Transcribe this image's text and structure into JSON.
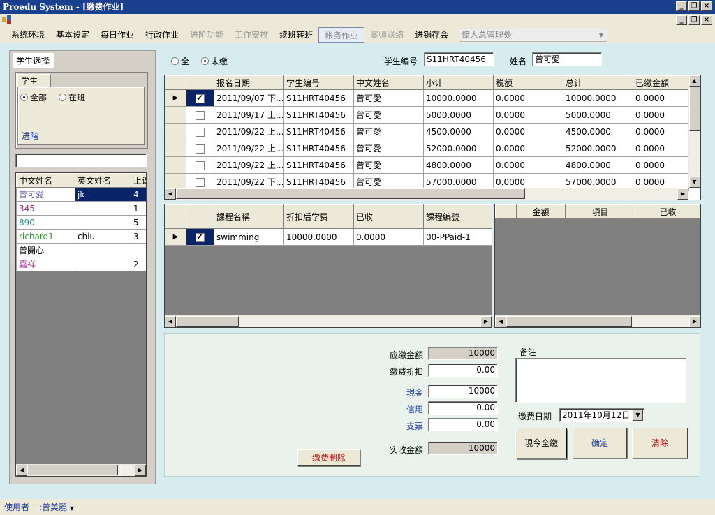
{
  "window": {
    "title": "Proedu System - [缴费作业]"
  },
  "menu": {
    "items": [
      {
        "label": "系统环境",
        "state": "normal"
      },
      {
        "label": "基本设定",
        "state": "normal"
      },
      {
        "label": "每日作业",
        "state": "normal"
      },
      {
        "label": "行政作业",
        "state": "normal"
      },
      {
        "label": "进阶功能",
        "state": "disabled"
      },
      {
        "label": "工作安排",
        "state": "disabled"
      },
      {
        "label": "续班转班",
        "state": "normal"
      },
      {
        "label": "帐务作业",
        "state": "boxed"
      },
      {
        "label": "案师联络",
        "state": "disabled"
      },
      {
        "label": "进销存会",
        "state": "normal"
      }
    ],
    "combo_value": "傑人总管理处"
  },
  "left": {
    "tab_label": "学生选择",
    "inner_tab_label": "学生",
    "radio_all": "全部",
    "radio_active": "在班",
    "advanced_link": "进階",
    "search_value": "",
    "student_grid": {
      "headers": [
        "中文姓名",
        "英文姓名",
        "上课"
      ],
      "rows": [
        {
          "cn": "曾可愛",
          "en": "jk",
          "n": "4",
          "color": "#6b5fb0",
          "selected": true
        },
        {
          "cn": "345",
          "en": "",
          "n": "1",
          "color": "#9b2a8a",
          "selected": false
        },
        {
          "cn": "890",
          "en": "",
          "n": "5",
          "color": "#2a8a8a",
          "selected": false
        },
        {
          "cn": "richard1",
          "en": "chiu",
          "n": "3",
          "color": "#2aa02a",
          "selected": false
        },
        {
          "cn": "曾開心",
          "en": "",
          "n": "",
          "color": "#000000",
          "selected": false
        },
        {
          "cn": "嘉祥",
          "en": "",
          "n": "2",
          "color": "#9b2a8a",
          "selected": false
        }
      ]
    }
  },
  "filter": {
    "radio_all": "全",
    "radio_unpaid": "未缴"
  },
  "student_info": {
    "id_label": "学生编号",
    "id_value": "S11HRT40456",
    "name_label": "姓名",
    "name_value": "曾可愛"
  },
  "fees_grid": {
    "headers": [
      "报名日期",
      "学生编号",
      "中文姓名",
      "小计",
      "税额",
      "总计",
      "已缴金額"
    ],
    "rows": [
      {
        "date": "2011/09/07 下...",
        "sid": "S11HRT40456",
        "name": "曾可愛",
        "sub": "10000.0000",
        "tax": "0.0000",
        "total": "10000.0000",
        "paid": "0.0000",
        "checked": true,
        "current": true
      },
      {
        "date": "2011/09/17 上...",
        "sid": "S11HRT40456",
        "name": "曾可愛",
        "sub": "5000.0000",
        "tax": "0.0000",
        "total": "5000.0000",
        "paid": "0.0000",
        "checked": false,
        "current": false
      },
      {
        "date": "2011/09/22 上...",
        "sid": "S11HRT40456",
        "name": "曾可愛",
        "sub": "4500.0000",
        "tax": "0.0000",
        "total": "4500.0000",
        "paid": "0.0000",
        "checked": false,
        "current": false
      },
      {
        "date": "2011/09/22 上...",
        "sid": "S11HRT40456",
        "name": "曾可愛",
        "sub": "52000.0000",
        "tax": "0.0000",
        "total": "52000.0000",
        "paid": "0.0000",
        "checked": false,
        "current": false
      },
      {
        "date": "2011/09/22 上...",
        "sid": "S11HRT40456",
        "name": "曾可愛",
        "sub": "4800.0000",
        "tax": "0.0000",
        "total": "4800.0000",
        "paid": "0.0000",
        "checked": false,
        "current": false
      },
      {
        "date": "2011/09/22 下...",
        "sid": "S11HRT40456",
        "name": "曾可愛",
        "sub": "57000.0000",
        "tax": "0.0000",
        "total": "57000.0000",
        "paid": "0.0000",
        "checked": false,
        "current": false
      }
    ]
  },
  "course_grid": {
    "headers": [
      "課程名稱",
      "折扣后学费",
      "已收",
      "課程編號"
    ],
    "rows": [
      {
        "name": "swimming",
        "fee": "10000.0000",
        "recv": "0.0000",
        "code": "00-PPaid-1",
        "checked": true
      }
    ]
  },
  "payment_grid": {
    "headers": [
      "金額",
      "項目",
      "已收"
    ]
  },
  "payment": {
    "due_label": "应缴金額",
    "due_value": "10000",
    "discount_label": "缴费折扣",
    "discount_value": "0.00",
    "cash_label": "現金",
    "cash_value": "10000",
    "credit_label": "信用",
    "credit_value": "0.00",
    "check_label": "支票",
    "check_value": "0.00",
    "actual_label": "实收金額",
    "actual_value": "10000",
    "note_label": "备注",
    "note_value": "",
    "date_label": "缴费日期",
    "date_value": "2011年10月12日"
  },
  "buttons": {
    "delete": "缴费删除",
    "pay_all": "現今全缴",
    "confirm": "确定",
    "clear": "清除"
  },
  "status": {
    "user_label": "使用者",
    "user_value": ":曾美麗"
  }
}
